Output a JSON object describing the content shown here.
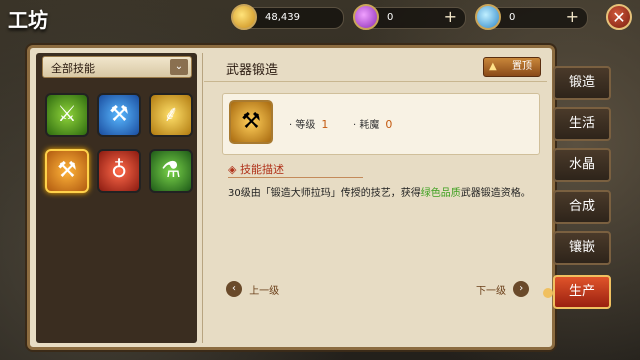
{
  "topbar": {
    "title": "工坊",
    "gold": "48,439",
    "gems": "0",
    "crystals": "0",
    "plus": "+",
    "close": "✕"
  },
  "left": {
    "filter_label": "全部技能",
    "chevron": "⌄",
    "skills": [
      {
        "icon": "axe-icon",
        "glyph": "⚔"
      },
      {
        "icon": "hammer-icon",
        "glyph": "⚒"
      },
      {
        "icon": "hook-icon",
        "glyph": "⸙"
      },
      {
        "icon": "anvil-icon",
        "glyph": "⚒"
      },
      {
        "icon": "gem-ring-icon",
        "glyph": "♁"
      },
      {
        "icon": "flask-icon",
        "glyph": "⚗"
      }
    ]
  },
  "detail": {
    "name": "武器锻造",
    "pin_label": "置顶",
    "level_label": "等级",
    "level_value": "1",
    "cost_label": "耗魔",
    "cost_value": "0",
    "desc_title": "技能描述",
    "desc_pre": "30级由「锻造大师拉玛」传授的技艺，获得",
    "desc_green": "绿色品质",
    "desc_post": "武器锻造资格。",
    "prev_label": "上一级",
    "next_label": "下一级"
  },
  "tabs": [
    "锻造",
    "生活",
    "水晶",
    "合成",
    "镶嵌",
    "生产"
  ],
  "active_tab": "生产"
}
